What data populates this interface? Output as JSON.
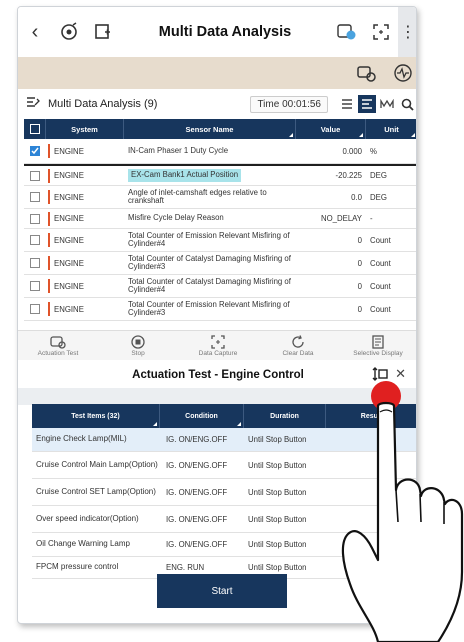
{
  "appbar": {
    "title": "Multi Data Analysis"
  },
  "header": {
    "label": "Multi Data Analysis (9)",
    "time": "Time 00:01:56"
  },
  "data_table": {
    "columns": [
      "System",
      "Sensor Name",
      "Value",
      "Unit"
    ],
    "rows": [
      {
        "system": "ENGINE",
        "sensor": "IN-Cam Phaser 1 Duty Cycle",
        "value": "0.000",
        "unit": "%",
        "checked": true
      },
      {
        "system": "ENGINE",
        "sensor": "EX-Cam Bank1 Actual Position",
        "value": "-20.225",
        "unit": "DEG",
        "checked": false
      },
      {
        "system": "ENGINE",
        "sensor": "Angle of inlet-camshaft edges relative to crankshaft",
        "value": "0.0",
        "unit": "DEG",
        "checked": false
      },
      {
        "system": "ENGINE",
        "sensor": "Misfire Cycle Delay Reason",
        "value": "NO_DELAY",
        "unit": "-",
        "checked": false
      },
      {
        "system": "ENGINE",
        "sensor": "Total Counter of Emission Relevant Misfiring of Cylinder#4",
        "value": "0",
        "unit": "Count",
        "checked": false
      },
      {
        "system": "ENGINE",
        "sensor": "Total Counter of Catalyst Damaging Misfiring of Cylinder#3",
        "value": "0",
        "unit": "Count",
        "checked": false
      },
      {
        "system": "ENGINE",
        "sensor": "Total Counter of Catalyst Damaging Misfiring of Cylinder#4",
        "value": "0",
        "unit": "Count",
        "checked": false
      },
      {
        "system": "ENGINE",
        "sensor": "Total Counter of Emission Relevant Misfiring of Cylinder#3",
        "value": "0",
        "unit": "Count",
        "checked": false
      }
    ]
  },
  "toolbar": {
    "actuation": "Actuation Test",
    "stop": "Stop",
    "capture": "Data Capture",
    "clear": "Clear Data",
    "selective": "Selective Display"
  },
  "actuation": {
    "title": "Actuation Test  - Engine Control",
    "columns": [
      "Test Items (32)",
      "Condition",
      "Duration",
      "Result"
    ],
    "rows": [
      {
        "item": "Engine Check Lamp(MIL)",
        "condition": "IG. ON/ENG.OFF",
        "duration": "Until Stop Button"
      },
      {
        "item": "Cruise Control Main Lamp(Option)",
        "condition": "IG. ON/ENG.OFF",
        "duration": "Until Stop Button"
      },
      {
        "item": "Cruise Control SET Lamp(Option)",
        "condition": "IG. ON/ENG.OFF",
        "duration": "Until Stop Button"
      },
      {
        "item": "Over speed indicator(Option)",
        "condition": "IG. ON/ENG.OFF",
        "duration": "Until Stop Button"
      },
      {
        "item": "Oil Change Warning Lamp",
        "condition": "IG. ON/ENG.OFF",
        "duration": "Until Stop Button"
      },
      {
        "item": "FPCM pressure control",
        "condition": "ENG. RUN",
        "duration": "Until Stop Button"
      }
    ],
    "start_label": "Start"
  },
  "colors": {
    "header_navy": "#17365d",
    "accent_red": "#e0532a",
    "highlight_cyan": "#a8e3ea",
    "strip_tan": "#e7dccd"
  }
}
